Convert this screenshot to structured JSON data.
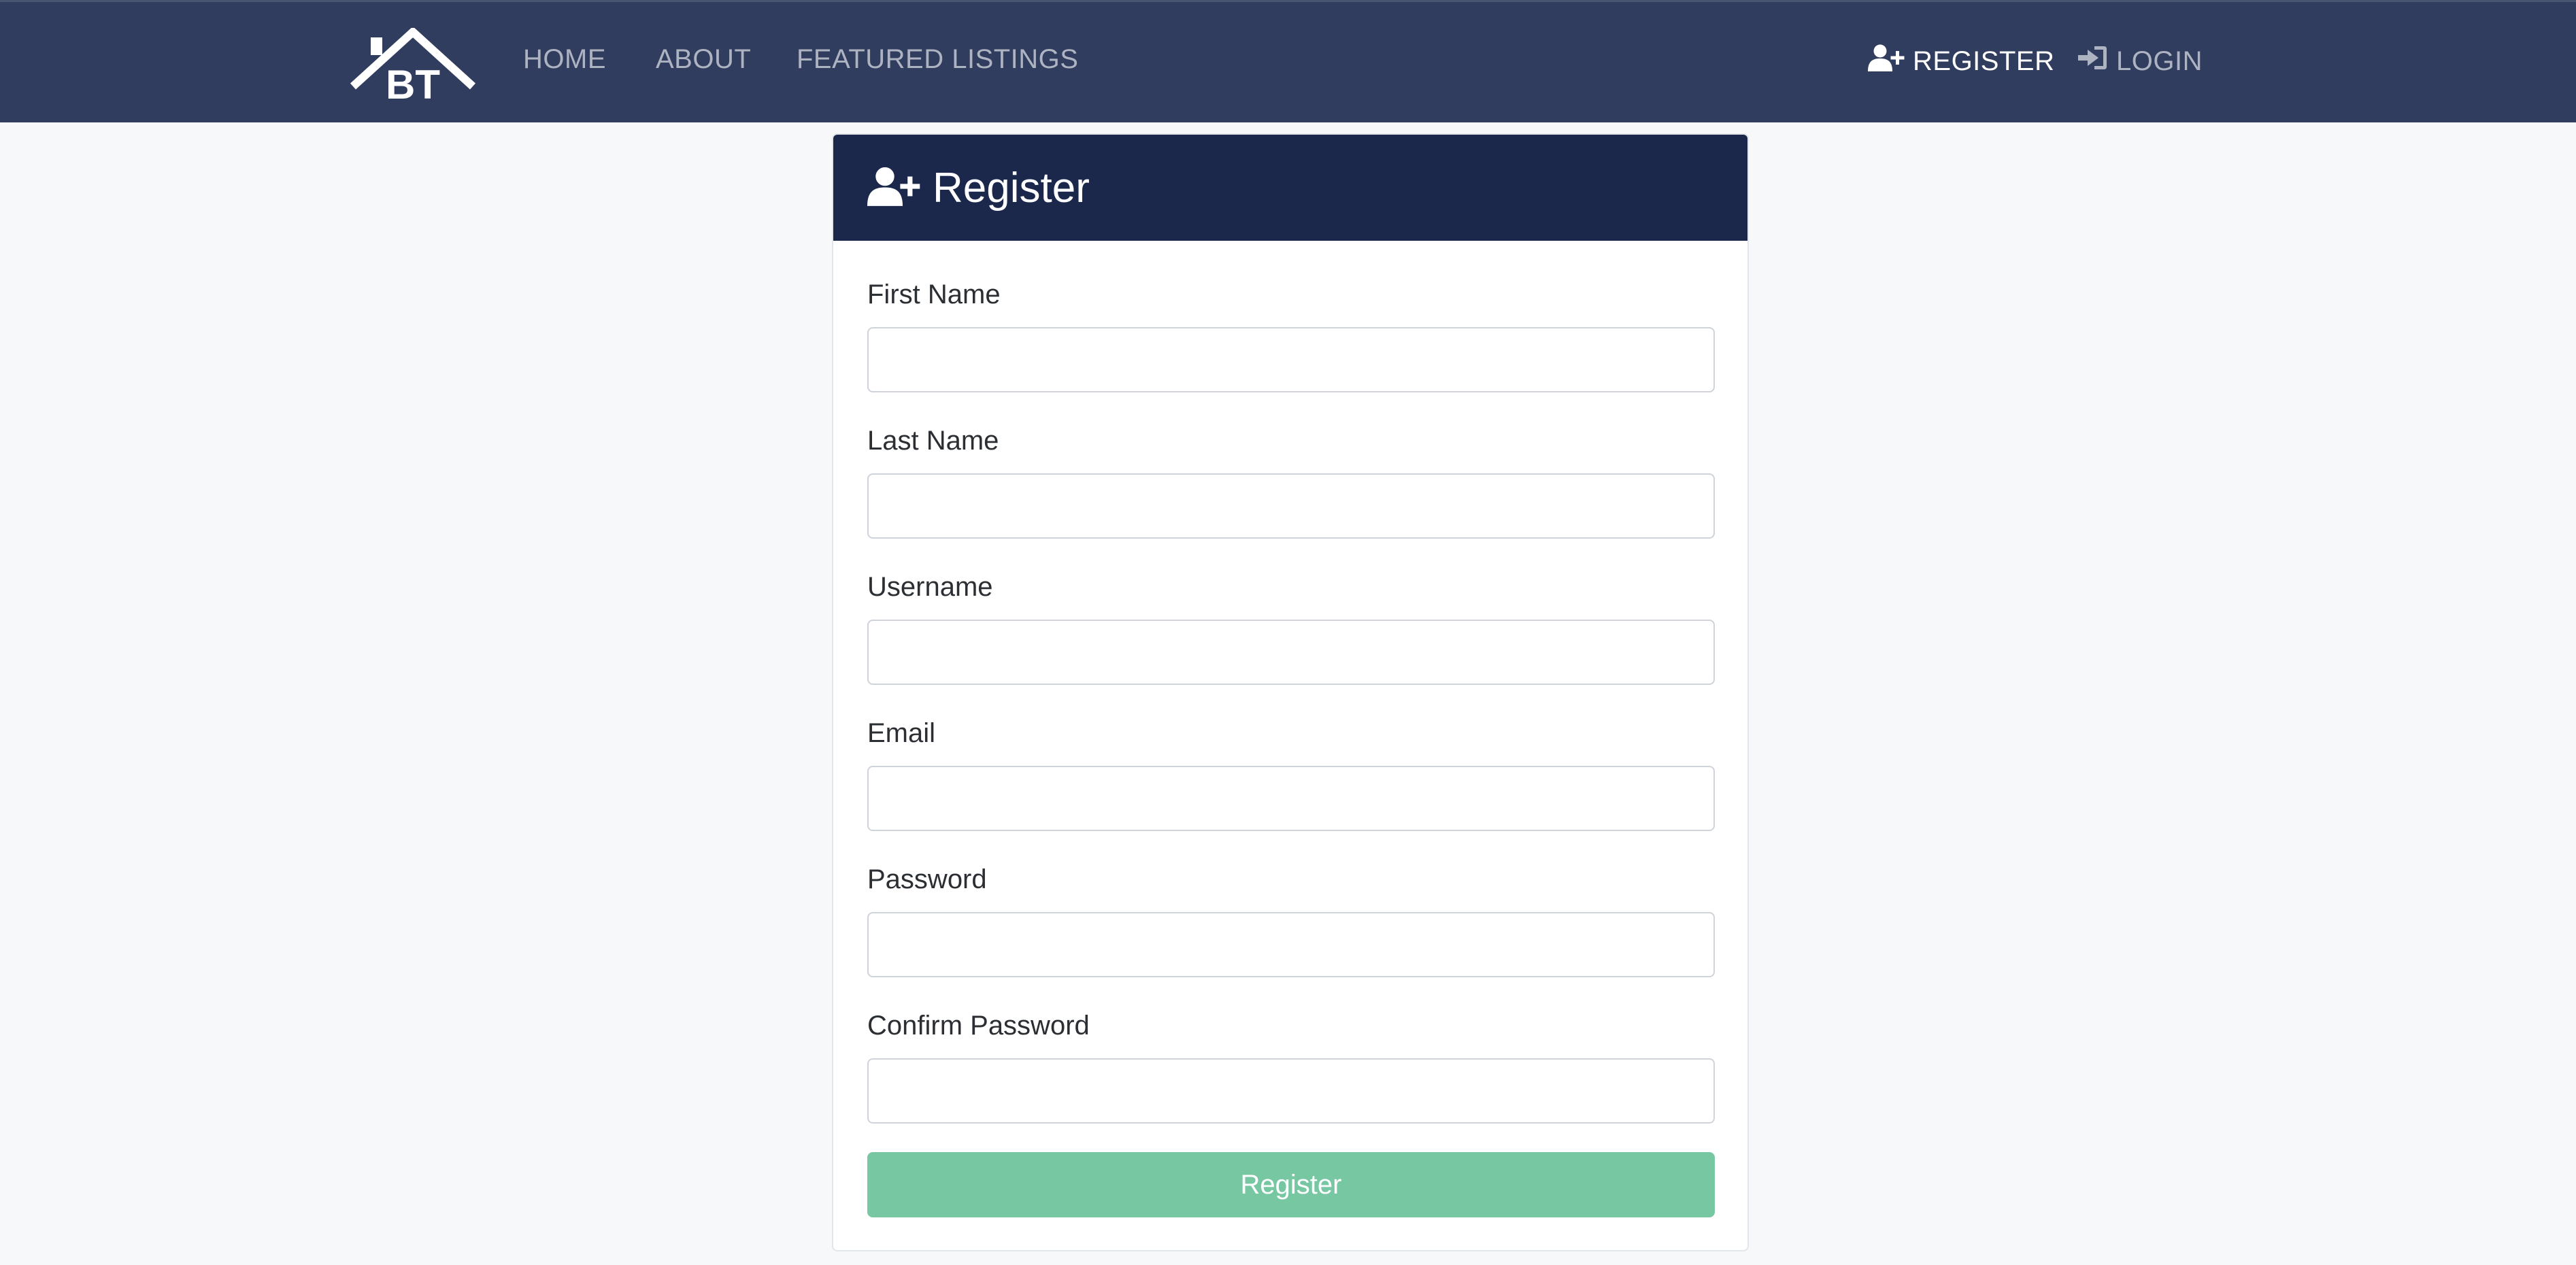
{
  "colors": {
    "navbar_bg": "#313d5e",
    "card_header_bg": "#1c274c",
    "page_bg": "#f7f8fa",
    "submit_bg": "#77c7a3",
    "nav_inactive": "#aeb3c2",
    "nav_active": "#ffffff"
  },
  "navbar": {
    "logo_text": "BT",
    "logo_icon": "house-roof-logo",
    "links": [
      {
        "label": "HOME"
      },
      {
        "label": "ABOUT"
      },
      {
        "label": "FEATURED LISTINGS"
      }
    ],
    "register": {
      "label": "REGISTER",
      "icon": "user-plus-icon",
      "active": true
    },
    "login": {
      "label": "LOGIN",
      "icon": "sign-in-icon",
      "active": false
    }
  },
  "card": {
    "title": "Register",
    "title_icon": "user-plus-icon",
    "fields": [
      {
        "label": "First Name",
        "value": "",
        "placeholder": ""
      },
      {
        "label": "Last Name",
        "value": "",
        "placeholder": ""
      },
      {
        "label": "Username",
        "value": "",
        "placeholder": ""
      },
      {
        "label": "Email",
        "value": "",
        "placeholder": ""
      },
      {
        "label": "Password",
        "value": "",
        "placeholder": ""
      },
      {
        "label": "Confirm Password",
        "value": "",
        "placeholder": ""
      }
    ],
    "submit_label": "Register"
  }
}
